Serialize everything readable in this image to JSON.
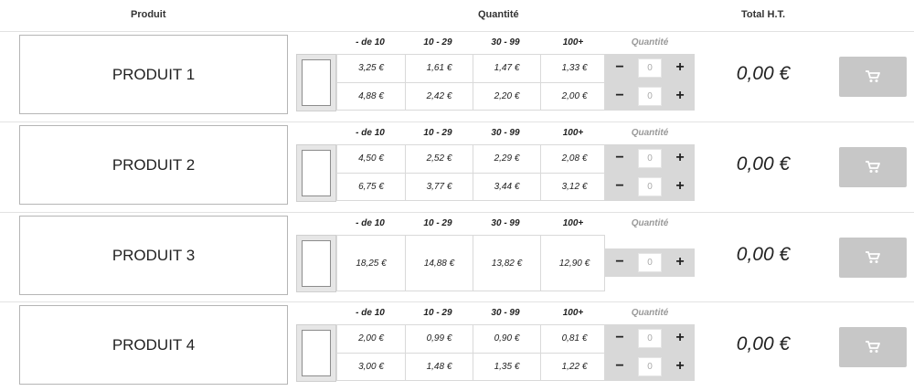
{
  "header": {
    "product": "Produit",
    "quantity": "Quantité",
    "total": "Total H.T."
  },
  "tiers": [
    "- de 10",
    "10 - 29",
    "30 - 99",
    "100+"
  ],
  "quantity_label": "Quantité",
  "qty_controls": {
    "minus": "−",
    "plus": "+"
  },
  "products": [
    {
      "name": "PRODUIT 1",
      "total": "0,00 €",
      "price_rows": [
        {
          "prices": [
            "3,25 €",
            "1,61 €",
            "1,47 €",
            "1,33 €"
          ],
          "qty": "0"
        },
        {
          "prices": [
            "4,88 €",
            "2,42 €",
            "2,20 €",
            "2,00 €"
          ],
          "qty": "0"
        }
      ]
    },
    {
      "name": "PRODUIT 2",
      "total": "0,00 €",
      "price_rows": [
        {
          "prices": [
            "4,50 €",
            "2,52 €",
            "2,29 €",
            "2,08 €"
          ],
          "qty": "0"
        },
        {
          "prices": [
            "6,75 €",
            "3,77 €",
            "3,44 €",
            "3,12 €"
          ],
          "qty": "0"
        }
      ]
    },
    {
      "name": "PRODUIT 3",
      "total": "0,00 €",
      "price_rows": [
        {
          "prices": [
            "18,25 €",
            "14,88 €",
            "13,82 €",
            "12,90 €"
          ],
          "qty": "0"
        }
      ]
    },
    {
      "name": "PRODUIT 4",
      "total": "0,00 €",
      "price_rows": [
        {
          "prices": [
            "2,00 €",
            "0,99 €",
            "0,90 €",
            "0,81 €"
          ],
          "qty": "0"
        },
        {
          "prices": [
            "3,00 €",
            "1,48 €",
            "1,35 €",
            "1,22 €"
          ],
          "qty": "0"
        }
      ]
    }
  ],
  "icons": {
    "cart": "shopping-cart-icon"
  },
  "colors": {
    "qty_bg": "#d8d8d8",
    "cart_button": "#c7c7c7",
    "quantity_label": "#999999"
  }
}
